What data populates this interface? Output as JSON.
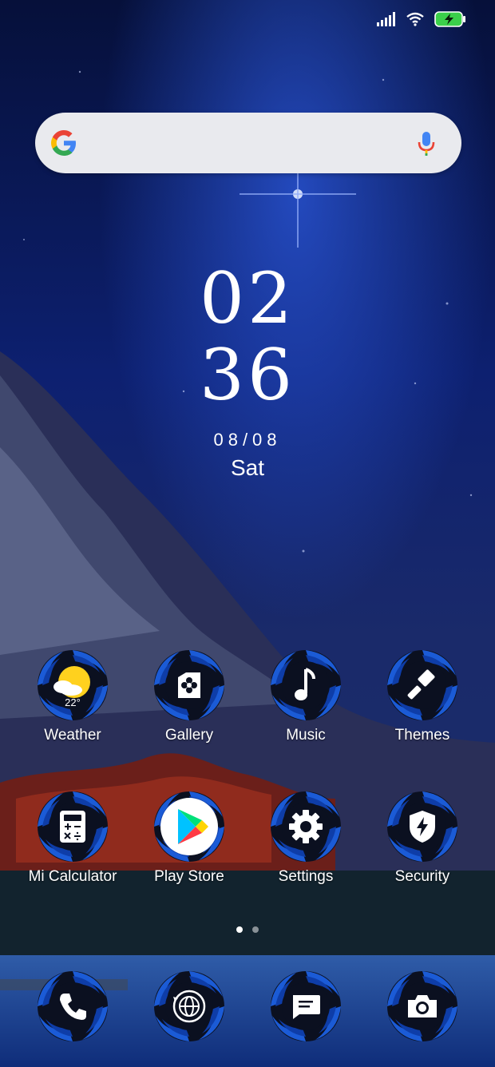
{
  "status_bar": {
    "signal_icon": "cell-signal-icon",
    "wifi_icon": "wifi-icon",
    "battery_icon": "battery-charging-icon",
    "battery_color": "#3bd04a"
  },
  "search": {
    "logo_icon": "google-g-icon",
    "mic_icon": "microphone-icon"
  },
  "clock": {
    "hour": "02",
    "minute": "36",
    "date": "08/08",
    "day": "Sat"
  },
  "apps": [
    {
      "label": "Weather",
      "icon": "weather-sun-cloud-icon",
      "temp": "22°"
    },
    {
      "label": "Gallery",
      "icon": "gallery-flower-icon"
    },
    {
      "label": "Music",
      "icon": "music-note-icon"
    },
    {
      "label": "Themes",
      "icon": "paintbrush-icon"
    },
    {
      "label": "Mi Calculator",
      "icon": "calculator-icon"
    },
    {
      "label": "Play Store",
      "icon": "play-store-icon"
    },
    {
      "label": "Settings",
      "icon": "gear-icon"
    },
    {
      "label": "Security",
      "icon": "shield-bolt-icon"
    }
  ],
  "dock": [
    {
      "icon": "phone-icon"
    },
    {
      "icon": "browser-globe-icon"
    },
    {
      "icon": "messages-icon"
    },
    {
      "icon": "camera-icon"
    }
  ],
  "pager": {
    "pages": 2,
    "active": 1
  },
  "colors": {
    "accent_blue": "#1b5bd6",
    "icon_bg": "#0b1020"
  }
}
